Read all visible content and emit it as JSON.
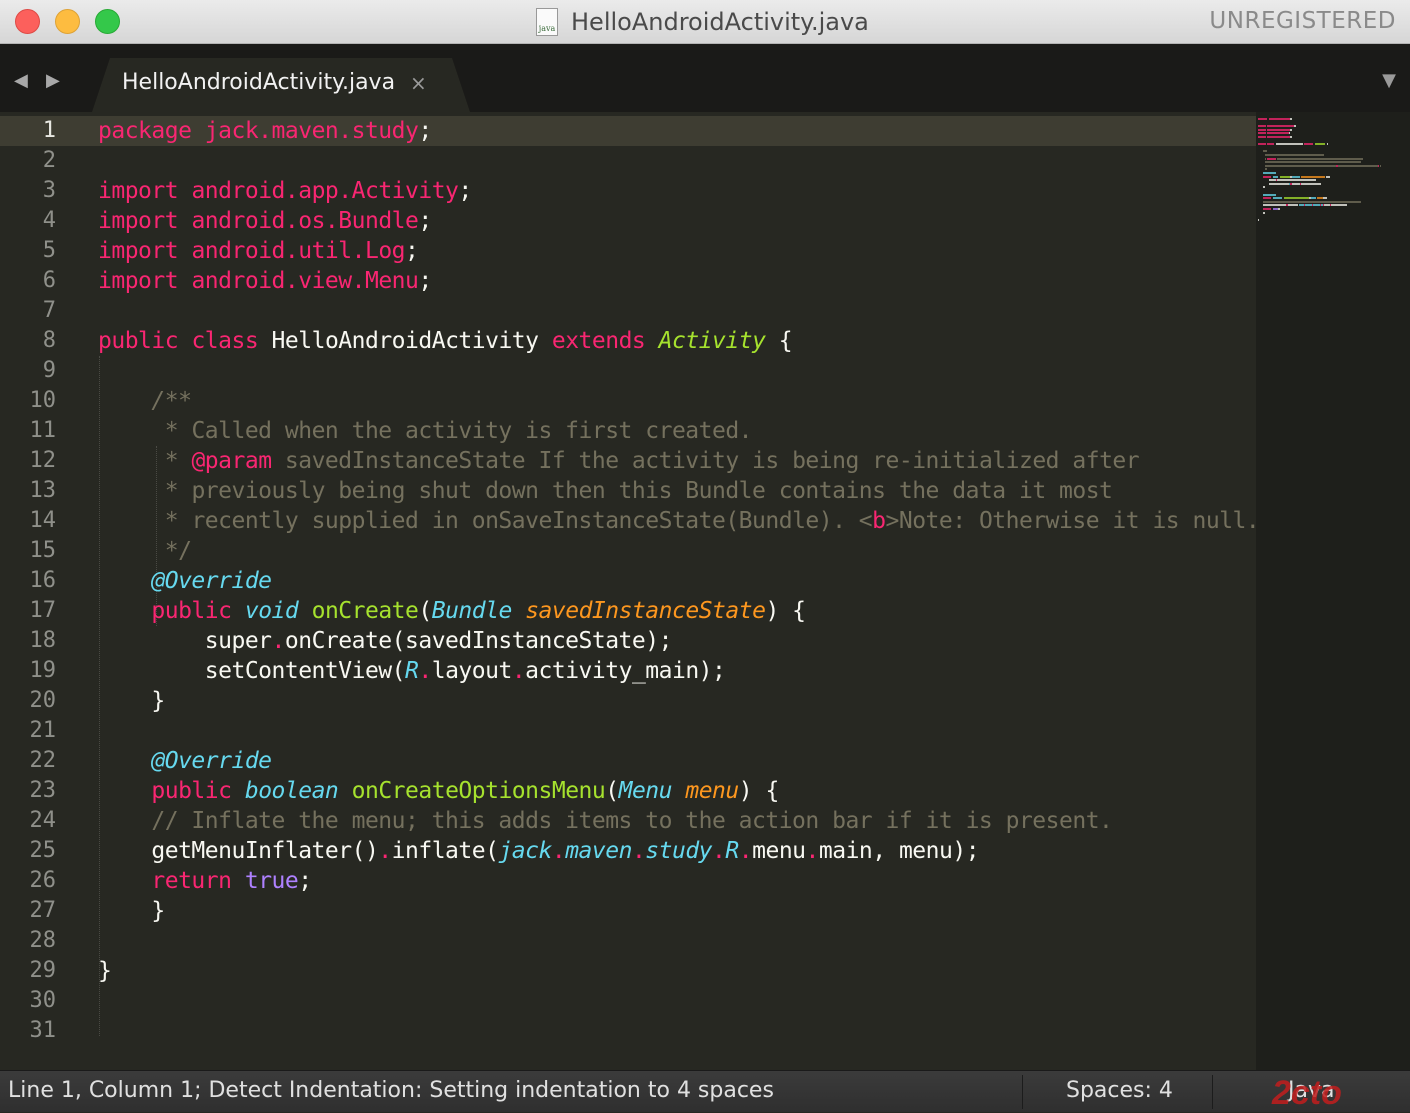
{
  "window": {
    "title": "HelloAndroidActivity.java",
    "file_icon_text": "java",
    "registration": "UNREGISTERED"
  },
  "tabbar": {
    "nav_back": "◀",
    "nav_forward": "▶",
    "active_tab": "HelloAndroidActivity.java",
    "close_glyph": "×",
    "menu_glyph": "▼"
  },
  "editor": {
    "current_line": 1,
    "line_numbers": [
      "1",
      "2",
      "3",
      "4",
      "5",
      "6",
      "7",
      "8",
      "9",
      "10",
      "11",
      "12",
      "13",
      "14",
      "15",
      "16",
      "17",
      "18",
      "19",
      "20",
      "21",
      "22",
      "23",
      "24",
      "25",
      "26",
      "27",
      "28",
      "29",
      "30",
      "31"
    ],
    "lines": [
      [
        [
          "k",
          "package"
        ],
        [
          "p",
          " "
        ],
        [
          "k",
          "jack.maven.study"
        ],
        [
          "p",
          ";"
        ]
      ],
      [],
      [
        [
          "k",
          "import"
        ],
        [
          "p",
          " "
        ],
        [
          "k",
          "android.app.Activity"
        ],
        [
          "p",
          ";"
        ]
      ],
      [
        [
          "k",
          "import"
        ],
        [
          "p",
          " "
        ],
        [
          "k",
          "android.os.Bundle"
        ],
        [
          "p",
          ";"
        ]
      ],
      [
        [
          "k",
          "import"
        ],
        [
          "p",
          " "
        ],
        [
          "k",
          "android.util.Log"
        ],
        [
          "p",
          ";"
        ]
      ],
      [
        [
          "k",
          "import"
        ],
        [
          "p",
          " "
        ],
        [
          "k",
          "android.view.Menu"
        ],
        [
          "p",
          ";"
        ]
      ],
      [],
      [
        [
          "k",
          "public"
        ],
        [
          "p",
          " "
        ],
        [
          "k",
          "class"
        ],
        [
          "p",
          " HelloAndroidActivity "
        ],
        [
          "k",
          "extends"
        ],
        [
          "p",
          " "
        ],
        [
          "ic",
          "Activity"
        ],
        [
          "p",
          " {"
        ]
      ],
      [],
      [
        [
          "p",
          "    "
        ],
        [
          "ci",
          "/**"
        ]
      ],
      [
        [
          "p",
          "     "
        ],
        [
          "c",
          "* Called when the activity is first created."
        ]
      ],
      [
        [
          "p",
          "     "
        ],
        [
          "c",
          "* "
        ],
        [
          "k",
          "@param"
        ],
        [
          "c",
          " savedInstanceState If the activity is being re-initialized after"
        ]
      ],
      [
        [
          "p",
          "     "
        ],
        [
          "c",
          "* previously being shut down then this Bundle contains the data it most"
        ]
      ],
      [
        [
          "p",
          "     "
        ],
        [
          "c",
          "* recently supplied in onSaveInstanceState(Bundle). <"
        ],
        [
          "k",
          "b"
        ],
        [
          "c",
          ">Note: Otherwise it is null.</"
        ],
        [
          "k",
          "b"
        ],
        [
          "c",
          ">"
        ]
      ],
      [
        [
          "p",
          "     "
        ],
        [
          "c",
          "*/"
        ]
      ],
      [
        [
          "p",
          "    "
        ],
        [
          "t",
          "@Override"
        ]
      ],
      [
        [
          "p",
          "    "
        ],
        [
          "k",
          "public"
        ],
        [
          "p",
          " "
        ],
        [
          "t",
          "void"
        ],
        [
          "p",
          " "
        ],
        [
          "f",
          "onCreate"
        ],
        [
          "p",
          "("
        ],
        [
          "t",
          "Bundle"
        ],
        [
          "p",
          " "
        ],
        [
          "a",
          "savedInstanceState"
        ],
        [
          "p",
          ") {"
        ]
      ],
      [
        [
          "p",
          "        super"
        ],
        [
          "k",
          "."
        ],
        [
          "p",
          "onCreate(savedInstanceState);"
        ]
      ],
      [
        [
          "p",
          "        setContentView("
        ],
        [
          "t",
          "R"
        ],
        [
          "k",
          "."
        ],
        [
          "p",
          "layout"
        ],
        [
          "k",
          "."
        ],
        [
          "p",
          "activity_main);"
        ]
      ],
      [
        [
          "p",
          "    }"
        ]
      ],
      [],
      [
        [
          "p",
          "    "
        ],
        [
          "t",
          "@Override"
        ]
      ],
      [
        [
          "p",
          "    "
        ],
        [
          "k",
          "public"
        ],
        [
          "p",
          " "
        ],
        [
          "t",
          "boolean"
        ],
        [
          "p",
          " "
        ],
        [
          "f",
          "onCreateOptionsMenu"
        ],
        [
          "p",
          "("
        ],
        [
          "t",
          "Menu"
        ],
        [
          "p",
          " "
        ],
        [
          "a",
          "menu"
        ],
        [
          "p",
          ") {"
        ]
      ],
      [
        [
          "p",
          "    "
        ],
        [
          "c",
          "// Inflate the menu; this adds items to the action bar if it is present."
        ]
      ],
      [
        [
          "p",
          "    getMenuInflater()"
        ],
        [
          "k",
          "."
        ],
        [
          "p",
          "inflate("
        ],
        [
          "t",
          "jack"
        ],
        [
          "k",
          "."
        ],
        [
          "t",
          "maven"
        ],
        [
          "k",
          "."
        ],
        [
          "t",
          "study"
        ],
        [
          "k",
          "."
        ],
        [
          "t",
          "R"
        ],
        [
          "k",
          "."
        ],
        [
          "p",
          "menu"
        ],
        [
          "k",
          "."
        ],
        [
          "p",
          "main, menu);"
        ]
      ],
      [
        [
          "p",
          "    "
        ],
        [
          "k",
          "return"
        ],
        [
          "p",
          " "
        ],
        [
          "pl",
          "true"
        ],
        [
          "p",
          ";"
        ]
      ],
      [
        [
          "p",
          "    }"
        ]
      ],
      [],
      [
        [
          "p",
          "}"
        ]
      ],
      [],
      []
    ]
  },
  "statusbar": {
    "message": "Line 1, Column 1; Detect Indentation: Setting indentation to 4 spaces",
    "spaces": "Spaces: 4",
    "syntax": "Java"
  },
  "watermark": "2cto",
  "colors": {
    "keyword": "#f92672",
    "type": "#66d9ef",
    "function": "#a6e22e",
    "argument": "#fd971f",
    "comment": "#75715e",
    "constant": "#ae81ff",
    "plain": "#f8f8f2",
    "background": "#272822"
  }
}
